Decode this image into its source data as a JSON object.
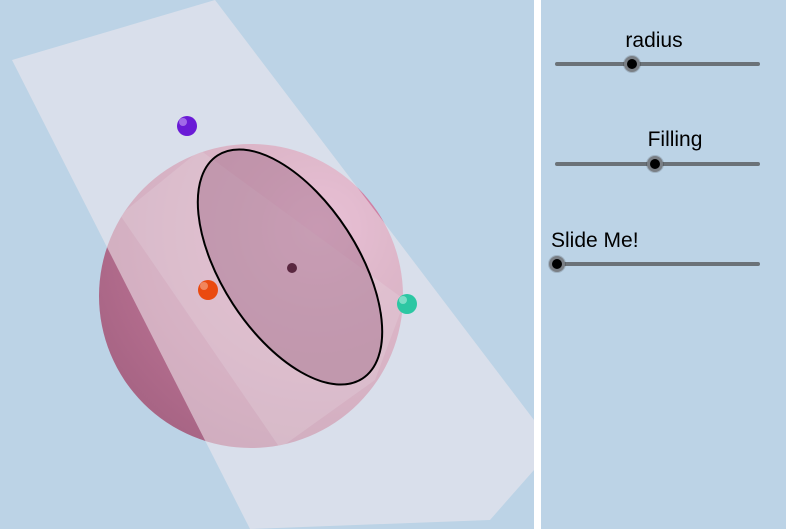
{
  "sliders": [
    {
      "label": "radius",
      "value_fraction": 0.375
    },
    {
      "label": "Filling",
      "value_fraction": 0.49
    },
    {
      "label": "Slide Me!",
      "value_fraction": 0.0
    }
  ],
  "colors": {
    "background": "#bcd3e6",
    "sphere": "#b06a8a",
    "point_purple": "#6a1ad6",
    "point_orange": "#ea4a10",
    "point_teal": "#2cc7a3",
    "track": "#6b7278"
  }
}
